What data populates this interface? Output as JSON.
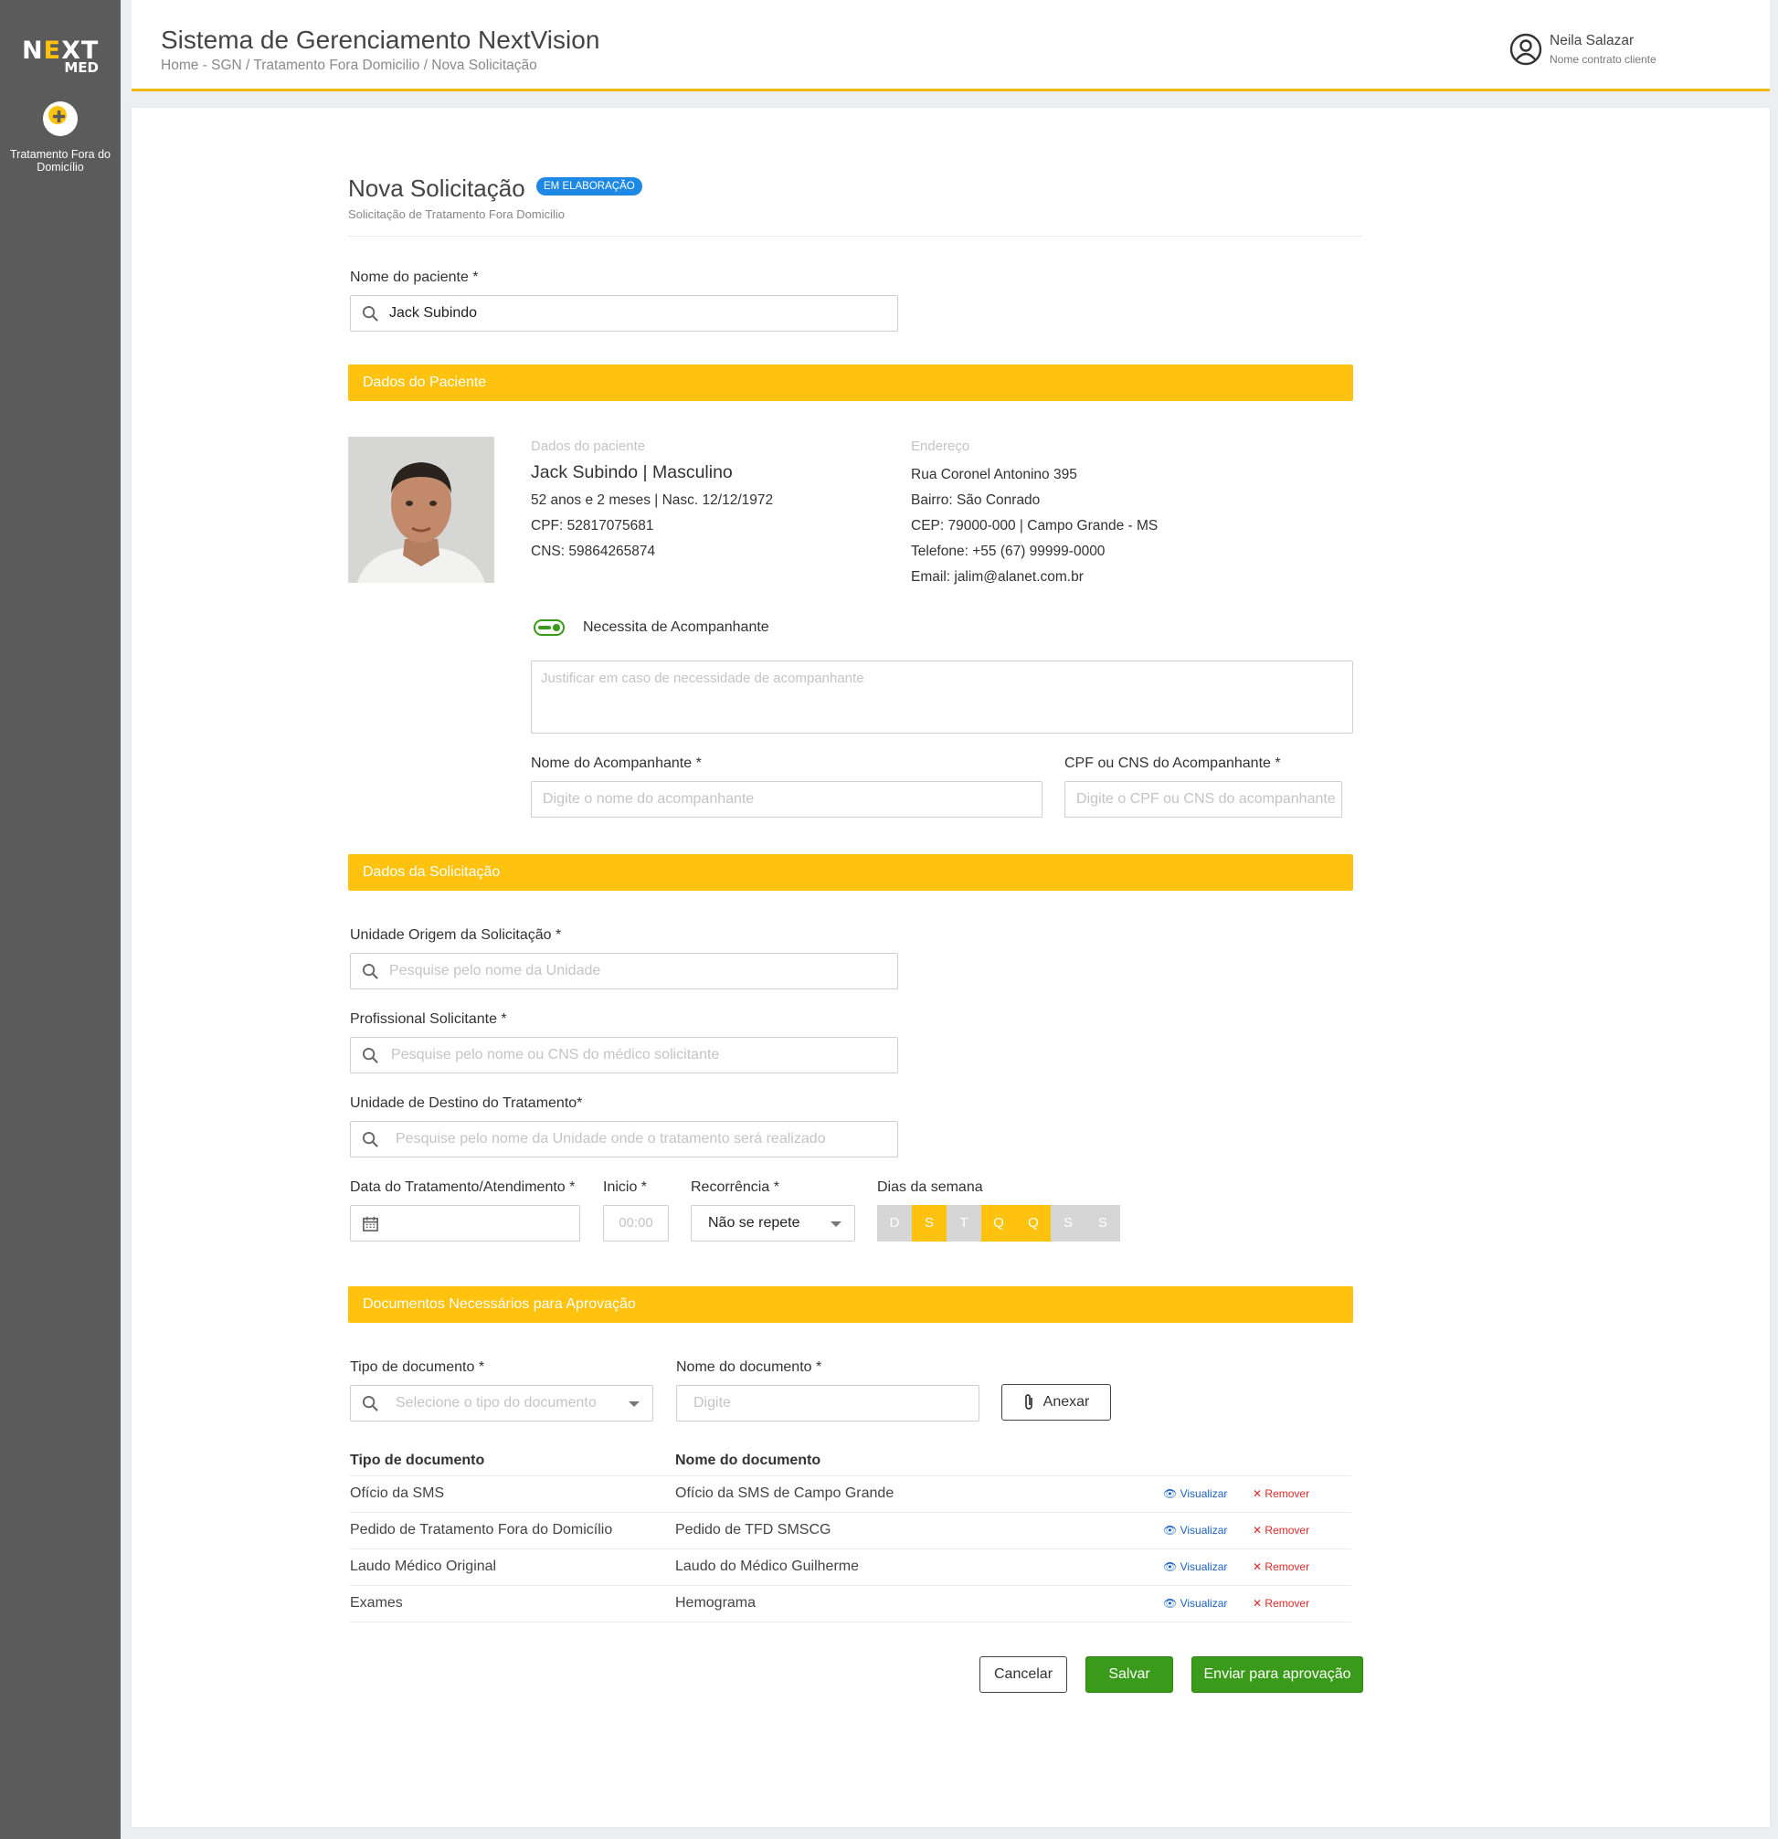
{
  "sidebar": {
    "logo_top": "NEXT",
    "logo_bottom": "MED",
    "module_label": "Tratamento Fora do Domicílio",
    "module_icon": "tfd-module-icon"
  },
  "header": {
    "title": "Sistema de Gerenciamento NextVision",
    "breadcrumb": "Home - SGN  / Tratamento Fora Domicilio / Nova Solicitação",
    "user_name": "Neila Salazar",
    "user_contract": "Nome contrato cliente",
    "user_icon": "user-circle-icon"
  },
  "page": {
    "title": "Nova Solicitação",
    "status_badge": "EM ELABORAÇÃO",
    "subtitle": "Solicitação de Tratamento Fora Domicilio"
  },
  "patient_search": {
    "label": "Nome do paciente *",
    "value": "Jack Subindo"
  },
  "sections": {
    "patient": "Dados do Paciente",
    "request": "Dados da Solicitação",
    "documents": "Documentos Necessários para Aprovação"
  },
  "patient_data": {
    "heading": "Dados do paciente",
    "name_sex": "Jack Subindo | Masculino",
    "age_birth": "52 anos e 2 meses | Nasc. 12/12/1972",
    "cpf": "CPF: 52817075681",
    "cns": "CNS: 59864265874"
  },
  "address": {
    "heading": "Endereço",
    "street": "Rua Coronel Antonino 395",
    "district": "Bairro: São Conrado",
    "cep_city": "CEP: 79000-000 | Campo Grande - MS",
    "phone": "Telefone: +55 (67) 99999-0000",
    "email": "Email: jalim@alanet.com.br"
  },
  "companion": {
    "toggle_label": "Necessita de Acompanhante",
    "toggle_on": true,
    "justification_placeholder": "Justificar em caso de necessidade de acompanhante",
    "name_label": "Nome do Acompanhante *",
    "name_placeholder": "Digite o nome do acompanhante",
    "doc_label": "CPF ou CNS do Acompanhante *",
    "doc_placeholder": "Digite o CPF ou CNS do acompanhante"
  },
  "request": {
    "origin_label": "Unidade Origem da Solicitação *",
    "origin_placeholder": "Pesquise pelo nome da Unidade",
    "professional_label": "Profissional Solicitante *",
    "professional_placeholder": "Pesquise pelo nome ou CNS do médico solicitante",
    "destination_label": "Unidade de Destino do Tratamento*",
    "destination_placeholder": "Pesquise pelo nome da Unidade onde o tratamento será realizado",
    "date_label": "Data do Tratamento/Atendimento *",
    "start_label": "Inicio *",
    "start_placeholder": "00:00",
    "recurrence_label": "Recorrência *",
    "recurrence_value": "Não se repete",
    "weekdays_label": "Dias da semana",
    "weekdays": [
      {
        "letter": "D",
        "selected": false
      },
      {
        "letter": "S",
        "selected": true
      },
      {
        "letter": "T",
        "selected": false
      },
      {
        "letter": "Q",
        "selected": true
      },
      {
        "letter": "Q",
        "selected": true
      },
      {
        "letter": "S",
        "selected": false
      },
      {
        "letter": "S",
        "selected": false
      }
    ]
  },
  "documents": {
    "type_label": "Tipo de documento *",
    "type_placeholder": "Selecione o tipo do documento",
    "name_label": "Nome do documento *",
    "name_placeholder": "Digite",
    "attach_button": "Anexar",
    "table_headers": [
      "Tipo de documento",
      "Nome do documento"
    ],
    "view_label": "Visualizar",
    "remove_label": "Remover",
    "rows": [
      {
        "type": "Ofício da SMS",
        "name": "Ofício da SMS de Campo Grande"
      },
      {
        "type": "Pedido de Tratamento Fora do Domicílio",
        "name": "Pedido de TFD SMSCG"
      },
      {
        "type": "Laudo Médico Original",
        "name": "Laudo do Médico Guilherme"
      },
      {
        "type": "Exames",
        "name": "Hemograma"
      }
    ]
  },
  "actions": {
    "cancel": "Cancelar",
    "save": "Salvar",
    "submit": "Enviar para aprovação"
  },
  "colors": {
    "accent": "#ffc20e",
    "success": "#3a9a19",
    "badge": "#1e88e5",
    "sidebar": "#5b5b5b"
  }
}
